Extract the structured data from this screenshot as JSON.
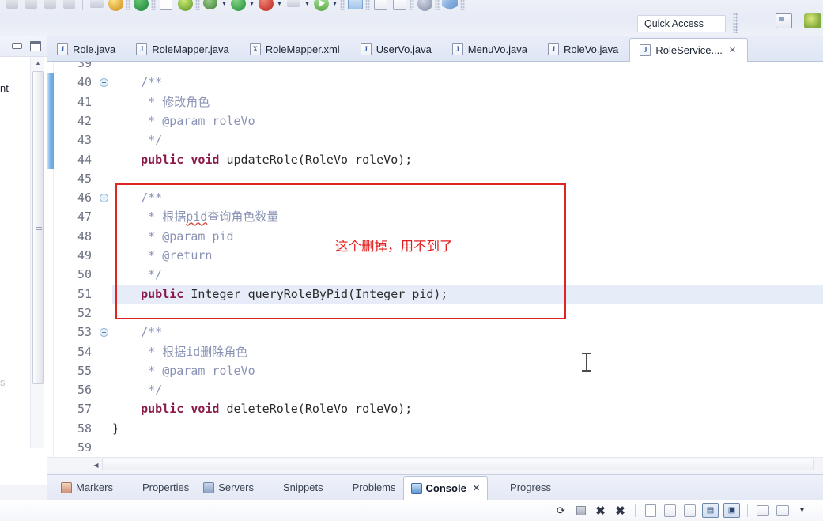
{
  "toolbar": {
    "quick_access": "Quick Access",
    "icons": [
      "undo-icon",
      "redo-icon",
      "back-icon",
      "forward-icon",
      "link-icon",
      "build-icon",
      "run-green-icon",
      "document-icon",
      "refresh-icon",
      "debug-bug-icon",
      "run-icon",
      "stop-red-icon",
      "skip-icon",
      "resume-icon",
      "open-folder-icon",
      "new-java-icon",
      "search-icon",
      "cube-icon"
    ],
    "right_icons": [
      "perspective-switch-icon",
      "java-perspective-icon"
    ]
  },
  "left_panel": {
    "minimize_icon": "minimize-icon",
    "maximize_icon": "maximize-icon",
    "visible_text": "nt",
    "fragment_text": "s"
  },
  "editor_tabs": [
    {
      "label": "Role.java",
      "icon": "java-file-icon",
      "icon_letter": "J",
      "active": false,
      "closable": false
    },
    {
      "label": "RoleMapper.java",
      "icon": "java-file-icon",
      "icon_letter": "J",
      "active": false,
      "closable": false
    },
    {
      "label": "RoleMapper.xml",
      "icon": "xml-file-icon",
      "icon_letter": "X",
      "active": false,
      "closable": false
    },
    {
      "label": "UserVo.java",
      "icon": "java-file-icon",
      "icon_letter": "J",
      "active": false,
      "closable": false
    },
    {
      "label": "MenuVo.java",
      "icon": "java-file-icon",
      "icon_letter": "J",
      "active": false,
      "closable": false
    },
    {
      "label": "RoleVo.java",
      "icon": "java-file-icon",
      "icon_letter": "J",
      "active": false,
      "closable": false
    },
    {
      "label": "RoleService....",
      "icon": "java-file-icon",
      "icon_letter": "J",
      "active": true,
      "closable": true
    }
  ],
  "tab_close_glyph": "✕",
  "code": {
    "first_partial_line": "39",
    "lines": [
      {
        "num": "40",
        "fold": true,
        "changed": true,
        "current": false,
        "segments": [
          {
            "t": "    ",
            "c": ""
          },
          {
            "t": "/**",
            "c": "cmt"
          }
        ]
      },
      {
        "num": "41",
        "fold": false,
        "changed": true,
        "current": false,
        "segments": [
          {
            "t": "     * ",
            "c": "cmt"
          },
          {
            "t": "修改角色",
            "c": "cmt-cn"
          }
        ]
      },
      {
        "num": "42",
        "fold": false,
        "changed": true,
        "current": false,
        "segments": [
          {
            "t": "     * @param roleVo",
            "c": "cmt"
          }
        ]
      },
      {
        "num": "43",
        "fold": false,
        "changed": true,
        "current": false,
        "segments": [
          {
            "t": "     */",
            "c": "cmt"
          }
        ]
      },
      {
        "num": "44",
        "fold": false,
        "changed": true,
        "current": false,
        "segments": [
          {
            "t": "    ",
            "c": ""
          },
          {
            "t": "public void ",
            "c": "kw"
          },
          {
            "t": "updateRole(RoleVo roleVo);",
            "c": "ty"
          }
        ]
      },
      {
        "num": "45",
        "fold": false,
        "changed": false,
        "current": false,
        "segments": []
      },
      {
        "num": "46",
        "fold": true,
        "changed": false,
        "current": false,
        "segments": [
          {
            "t": "    ",
            "c": ""
          },
          {
            "t": "/**",
            "c": "cmt"
          }
        ]
      },
      {
        "num": "47",
        "fold": false,
        "changed": false,
        "current": false,
        "segments": [
          {
            "t": "     * ",
            "c": "cmt"
          },
          {
            "t": "根据",
            "c": "cmt-cn"
          },
          {
            "t": "pid",
            "c": "cmt sq"
          },
          {
            "t": "查询角色数量",
            "c": "cmt-cn"
          }
        ]
      },
      {
        "num": "48",
        "fold": false,
        "changed": false,
        "current": false,
        "segments": [
          {
            "t": "     * @param pid",
            "c": "cmt"
          }
        ]
      },
      {
        "num": "49",
        "fold": false,
        "changed": false,
        "current": false,
        "segments": [
          {
            "t": "     * @return",
            "c": "cmt"
          }
        ]
      },
      {
        "num": "50",
        "fold": false,
        "changed": false,
        "current": false,
        "segments": [
          {
            "t": "     */",
            "c": "cmt"
          }
        ]
      },
      {
        "num": "51",
        "fold": false,
        "changed": false,
        "current": true,
        "segments": [
          {
            "t": "    ",
            "c": ""
          },
          {
            "t": "public ",
            "c": "kw"
          },
          {
            "t": "Integer queryRoleByPid(Integer pid);",
            "c": "ty"
          }
        ]
      },
      {
        "num": "52",
        "fold": false,
        "changed": false,
        "current": false,
        "segments": []
      },
      {
        "num": "53",
        "fold": true,
        "changed": false,
        "current": false,
        "segments": [
          {
            "t": "    ",
            "c": ""
          },
          {
            "t": "/**",
            "c": "cmt"
          }
        ]
      },
      {
        "num": "54",
        "fold": false,
        "changed": false,
        "current": false,
        "segments": [
          {
            "t": "     * ",
            "c": "cmt"
          },
          {
            "t": "根据",
            "c": "cmt-cn"
          },
          {
            "t": "id",
            "c": "cmt"
          },
          {
            "t": "删除角色",
            "c": "cmt-cn"
          }
        ]
      },
      {
        "num": "55",
        "fold": false,
        "changed": false,
        "current": false,
        "segments": [
          {
            "t": "     * @param roleVo",
            "c": "cmt"
          }
        ]
      },
      {
        "num": "56",
        "fold": false,
        "changed": false,
        "current": false,
        "segments": [
          {
            "t": "     */",
            "c": "cmt"
          }
        ]
      },
      {
        "num": "57",
        "fold": false,
        "changed": false,
        "current": false,
        "segments": [
          {
            "t": "    ",
            "c": ""
          },
          {
            "t": "public void ",
            "c": "kw"
          },
          {
            "t": "deleteRole(RoleVo roleVo);",
            "c": "ty"
          }
        ]
      },
      {
        "num": "58",
        "fold": false,
        "changed": false,
        "current": false,
        "segments": [
          {
            "t": "}",
            "c": "ty"
          }
        ]
      },
      {
        "num": "59",
        "fold": false,
        "changed": false,
        "current": false,
        "segments": []
      }
    ]
  },
  "annotation": {
    "text": "这个删掉，用不到了",
    "box_color": "#e02424",
    "text_color": "#e21d1d"
  },
  "bottom_tabs": [
    {
      "label": "Markers",
      "icon": "markers-icon",
      "active": false,
      "closable": false
    },
    {
      "label": "Properties",
      "icon": "properties-icon",
      "active": false,
      "closable": false
    },
    {
      "label": "Servers",
      "icon": "servers-icon",
      "active": false,
      "closable": false
    },
    {
      "label": "Snippets",
      "icon": "snippets-icon",
      "active": false,
      "closable": false
    },
    {
      "label": "Problems",
      "icon": "problems-icon",
      "active": false,
      "closable": false
    },
    {
      "label": "Console",
      "icon": "console-icon",
      "active": true,
      "closable": true
    },
    {
      "label": "Progress",
      "icon": "progress-icon",
      "active": false,
      "closable": false
    }
  ],
  "console_toolbar": {
    "icons": [
      "terminate-all-icon",
      "terminate-icon",
      "remove-launch-icon",
      "remove-all-launches-icon",
      "clear-console-icon",
      "scroll-lock-icon",
      "word-wrap-icon",
      "show-console-icon",
      "pin-console-icon",
      "new-console-icon",
      "display-menu-icon"
    ],
    "menu_glyph": "▾"
  },
  "colors": {
    "keyword": "#8b1a4a",
    "comment": "#8a93b5",
    "current_line": "#e6edf8",
    "changebar": "#63a6e0",
    "annotation_red": "#e02424",
    "tab_active_bg": "#ffffff"
  }
}
